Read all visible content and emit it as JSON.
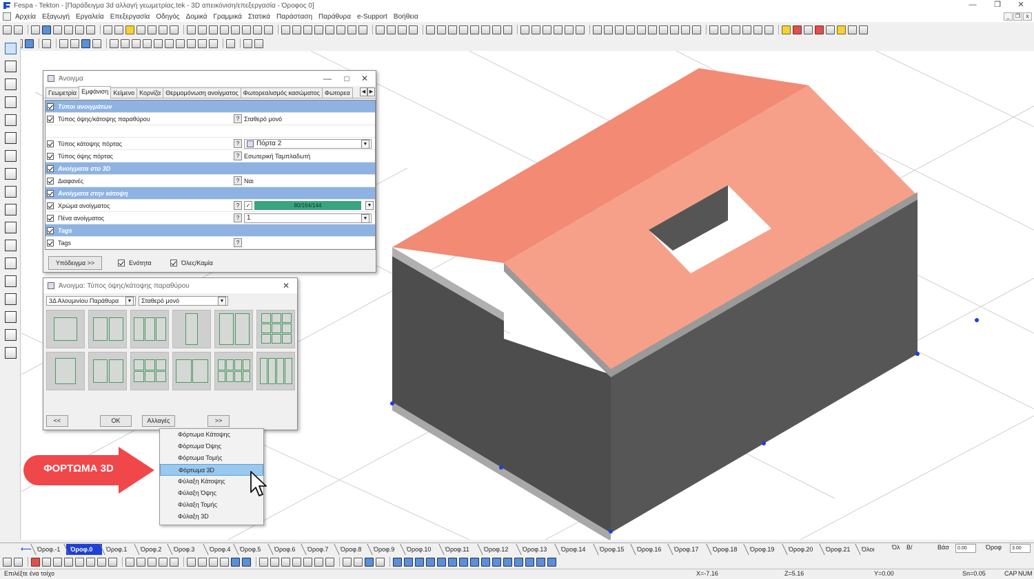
{
  "app": {
    "title": "Fespa - Tekton - [Παράδειγμα 3d αλλαγή γεωμετρίας.tek - 3D απεικόνιση/επεξεργασία - Όροφος 0]",
    "menu": [
      "Αρχεία",
      "Εξαγωγή",
      "Εργαλεία",
      "Επεξεργασία",
      "Οδηγός",
      "Δομικά",
      "Γραμμικά",
      "Στατικά",
      "Παράσταση",
      "Παράθυρα",
      "e-Support",
      "Βοήθεια"
    ]
  },
  "dialog_openings": {
    "title": "Άνοιγμα",
    "tabs": [
      "Γεωμετρία",
      "Εμφάνιση",
      "Κείμενο",
      "Κορνίζα",
      "Θερμομόνωση ανοίγματος",
      "Φωτορεαλισμός κασώματος",
      "Φωτορεα"
    ],
    "active_tab": "Εμφάνιση",
    "rows": [
      {
        "type": "header",
        "label": "Τύποι ανοιγμάτων"
      },
      {
        "type": "prop",
        "label": "Τύπος όψης/κάτοψης παραθύρου",
        "value": "Σταθερό μονό"
      },
      {
        "type": "blank"
      },
      {
        "type": "prop",
        "label": "Τύπος κάτοψης πόρτας",
        "value": "Πόρτα 2",
        "dropdown": true
      },
      {
        "type": "prop",
        "label": "Τύπος όψης πόρτας",
        "value": "Εσωτερική Ταμπλαδωτή"
      },
      {
        "type": "header",
        "label": "Ανοίγματα στο 3D"
      },
      {
        "type": "prop",
        "label": "Διαφανές",
        "value": "Ναι"
      },
      {
        "type": "header",
        "label": "Ανοίγματα στην κάτοψη"
      },
      {
        "type": "prop",
        "label": "Χρώμα ανοίγματος",
        "value": "80/164/144",
        "color": "#3aa37f",
        "dropdown": true
      },
      {
        "type": "prop",
        "label": "Πένα ανοίγματος",
        "value": "1",
        "dropdown": true
      },
      {
        "type": "header",
        "label": "Tags"
      },
      {
        "type": "prop",
        "label": "Tags",
        "value": ""
      }
    ],
    "template_button": "Υπόδειγμα >>",
    "unit_label": "Ενότητα",
    "all_none_label": "Όλες/Καμία"
  },
  "dialog_window_type": {
    "title": "Άνοιγμα: Τύπος όψης/κάτοψης παραθύρου",
    "category": "3Δ Αλουμινίου Παράθυρα",
    "type": "Σταθερό μονό",
    "prev_label": "<<",
    "ok_label": "OK",
    "changes_label": "Αλλαγές",
    "next_label": ">>"
  },
  "context_menu": {
    "items": [
      "Φόρτωμα Κάτοψης",
      "Φόρτωμα Όψης",
      "Φόρτωμα Τομής",
      "Φόρτωμα 3D",
      "Φύλαξη Κάτοψης",
      "Φύλαξη Όψης",
      "Φύλαξη Τομής",
      "Φύλαξη 3D"
    ],
    "selected_index": 3
  },
  "callout": {
    "text": "ΦΟΡΤΩΜΑ 3D",
    "color": "#f0474b"
  },
  "floors": {
    "tabs": [
      "Όροφ.-1",
      "Όροφ.0",
      "Όροφ.1",
      "Όροφ.2",
      "Όροφ.3",
      "Όροφ.4",
      "Όροφ.5",
      "Όροφ.6",
      "Όροφ.7",
      "Όροφ.8",
      "Όροφ.9",
      "Όροφ.10",
      "Όροφ.11",
      "Όροφ.12",
      "Όροφ.13",
      "Όροφ.14",
      "Όροφ.15",
      "Όροφ.16",
      "Όροφ.17",
      "Όροφ.18",
      "Όροφ.19",
      "Όροφ.20",
      "Όροφ.21",
      "Όλοι"
    ],
    "active_index": 1,
    "ola": "Όλ",
    "by": "Β/",
    "vas_label": "Βάσ",
    "vas_value": "0.00",
    "orof_label": "Όροφ",
    "orof_value": "3.00"
  },
  "status": {
    "prompt": "Επιλέξτε ένα τοίχο",
    "x": "X=-7.16",
    "z": "Z=5.16",
    "y": "Y=0.00",
    "sn": "Sn=0.05",
    "caps": "CAP",
    "num": "NUM"
  },
  "colors": {
    "roof": "#f28a74",
    "roof_light": "#f7a089",
    "wall_dark": "#4d4d4d",
    "wall_edge": "#9a9a9a",
    "floor_blue": "#1f3fd6"
  }
}
